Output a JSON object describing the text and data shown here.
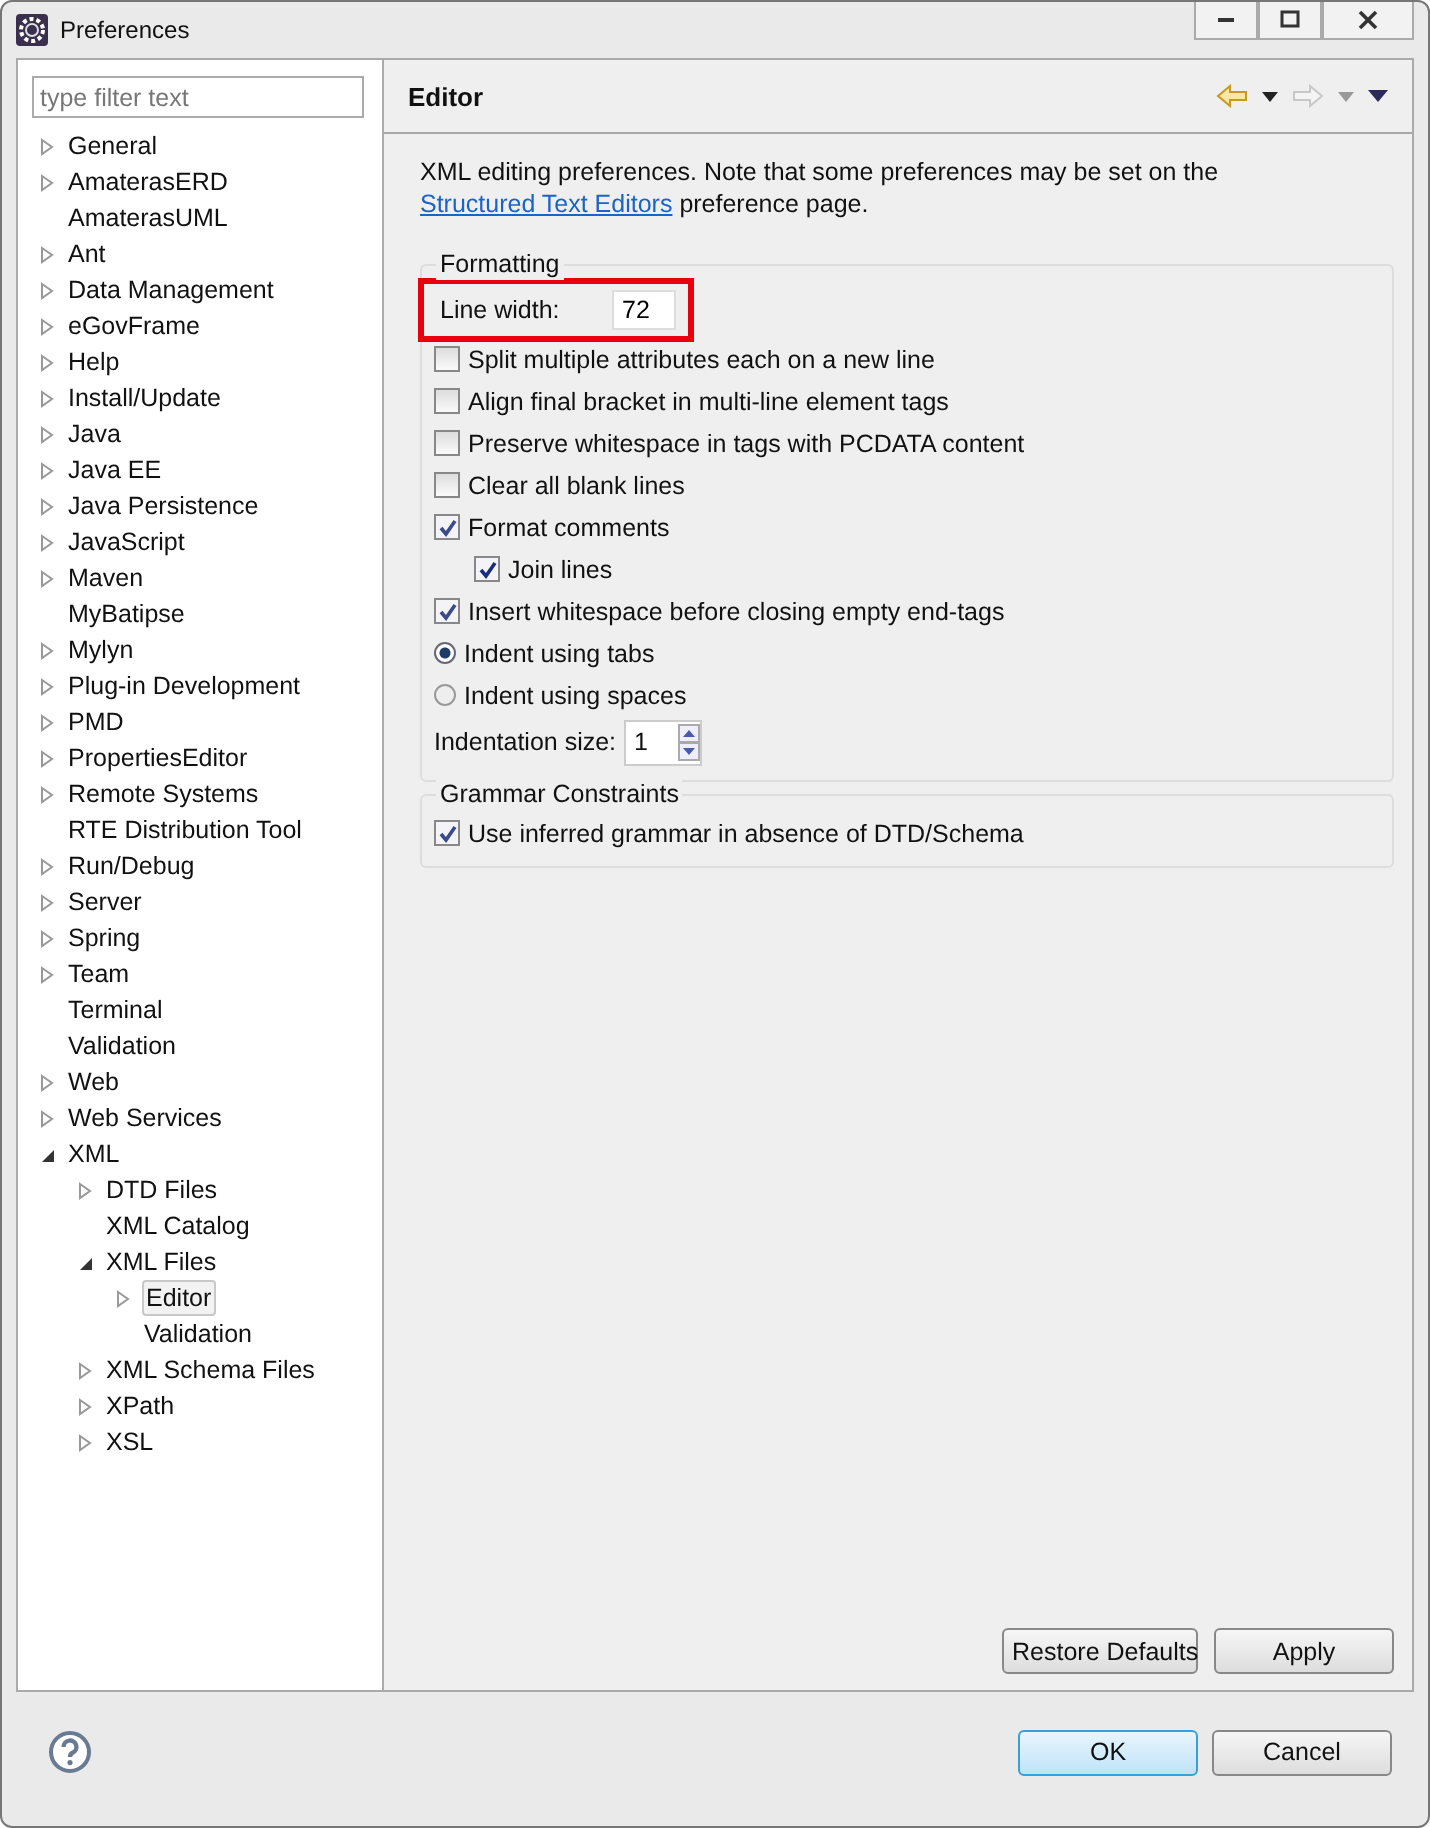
{
  "window": {
    "title": "Preferences"
  },
  "filter": {
    "placeholder": "type filter text"
  },
  "tree": [
    {
      "label": "General",
      "kind": "node",
      "expanded": false,
      "selected": false
    },
    {
      "label": "AmaterasERD",
      "kind": "node",
      "expanded": false,
      "selected": false
    },
    {
      "label": "AmaterasUML",
      "kind": "leaf",
      "selected": false
    },
    {
      "label": "Ant",
      "kind": "node",
      "expanded": false,
      "selected": false
    },
    {
      "label": "Data Management",
      "kind": "node",
      "expanded": false,
      "selected": false
    },
    {
      "label": "eGovFrame",
      "kind": "node",
      "expanded": false,
      "selected": false
    },
    {
      "label": "Help",
      "kind": "node",
      "expanded": false,
      "selected": false
    },
    {
      "label": "Install/Update",
      "kind": "node",
      "expanded": false,
      "selected": false
    },
    {
      "label": "Java",
      "kind": "node",
      "expanded": false,
      "selected": false
    },
    {
      "label": "Java EE",
      "kind": "node",
      "expanded": false,
      "selected": false
    },
    {
      "label": "Java Persistence",
      "kind": "node",
      "expanded": false,
      "selected": false
    },
    {
      "label": "JavaScript",
      "kind": "node",
      "expanded": false,
      "selected": false
    },
    {
      "label": "Maven",
      "kind": "node",
      "expanded": false,
      "selected": false
    },
    {
      "label": "MyBatipse",
      "kind": "leaf",
      "selected": false
    },
    {
      "label": "Mylyn",
      "kind": "node",
      "expanded": false,
      "selected": false
    },
    {
      "label": "Plug-in Development",
      "kind": "node",
      "expanded": false,
      "selected": false
    },
    {
      "label": "PMD",
      "kind": "node",
      "expanded": false,
      "selected": false
    },
    {
      "label": "PropertiesEditor",
      "kind": "node",
      "expanded": false,
      "selected": false
    },
    {
      "label": "Remote Systems",
      "kind": "node",
      "expanded": false,
      "selected": false
    },
    {
      "label": "RTE Distribution Tool",
      "kind": "leaf",
      "selected": false
    },
    {
      "label": "Run/Debug",
      "kind": "node",
      "expanded": false,
      "selected": false
    },
    {
      "label": "Server",
      "kind": "node",
      "expanded": false,
      "selected": false
    },
    {
      "label": "Spring",
      "kind": "node",
      "expanded": false,
      "selected": false
    },
    {
      "label": "Team",
      "kind": "node",
      "expanded": false,
      "selected": false
    },
    {
      "label": "Terminal",
      "kind": "leaf",
      "selected": false
    },
    {
      "label": "Validation",
      "kind": "leaf",
      "selected": false
    },
    {
      "label": "Web",
      "kind": "node",
      "expanded": false,
      "selected": false
    },
    {
      "label": "Web Services",
      "kind": "node",
      "expanded": false,
      "selected": false
    },
    {
      "label": "XML",
      "kind": "node",
      "expanded": true,
      "selected": false,
      "children": [
        {
          "label": "DTD Files",
          "kind": "node",
          "expanded": false,
          "selected": false
        },
        {
          "label": "XML Catalog",
          "kind": "leaf",
          "selected": false
        },
        {
          "label": "XML Files",
          "kind": "node",
          "expanded": true,
          "selected": false,
          "children": [
            {
              "label": "Editor",
              "kind": "node",
              "expanded": false,
              "selected": true
            },
            {
              "label": "Validation",
              "kind": "leaf",
              "selected": false
            }
          ]
        },
        {
          "label": "XML Schema Files",
          "kind": "node",
          "expanded": false,
          "selected": false
        },
        {
          "label": "XPath",
          "kind": "node",
          "expanded": false,
          "selected": false
        },
        {
          "label": "XSL",
          "kind": "node",
          "expanded": false,
          "selected": false
        }
      ]
    }
  ],
  "page": {
    "title": "Editor",
    "description": {
      "before": "XML editing preferences.  Note that some preferences may be set on the ",
      "link": "Structured Text Editors",
      "after": " preference page."
    },
    "groups": [
      {
        "title": "Formatting",
        "highlight": {
          "label": "Line width:",
          "value": "72"
        },
        "options": [
          {
            "kind": "checkbox",
            "label": "Split multiple attributes each on a new line",
            "checked": false
          },
          {
            "kind": "checkbox",
            "label": "Align final bracket in multi-line element tags",
            "checked": false
          },
          {
            "kind": "checkbox",
            "label": "Preserve whitespace in tags with PCDATA content",
            "checked": false
          },
          {
            "kind": "checkbox",
            "label": "Clear all blank lines",
            "checked": false
          },
          {
            "kind": "checkbox",
            "label": "Format comments",
            "checked": true,
            "children": [
              {
                "kind": "checkbox",
                "label": "Join lines",
                "checked": true
              }
            ]
          },
          {
            "kind": "checkbox",
            "label": "Insert whitespace before closing empty end-tags",
            "checked": true
          },
          {
            "kind": "radio",
            "label": "Indent using tabs",
            "selected": true
          },
          {
            "kind": "radio",
            "label": "Indent using spaces",
            "selected": false
          },
          {
            "kind": "spinner",
            "label": "Indentation size:",
            "value": "1"
          }
        ]
      },
      {
        "title": "Grammar Constraints",
        "options": [
          {
            "kind": "checkbox",
            "label": "Use inferred grammar in absence of DTD/Schema",
            "checked": true
          }
        ]
      }
    ]
  },
  "buttons": {
    "page": [
      "Restore Defaults",
      "Apply"
    ],
    "dialog": [
      {
        "label": "OK",
        "default": true
      },
      {
        "label": "Cancel",
        "default": false
      }
    ]
  }
}
